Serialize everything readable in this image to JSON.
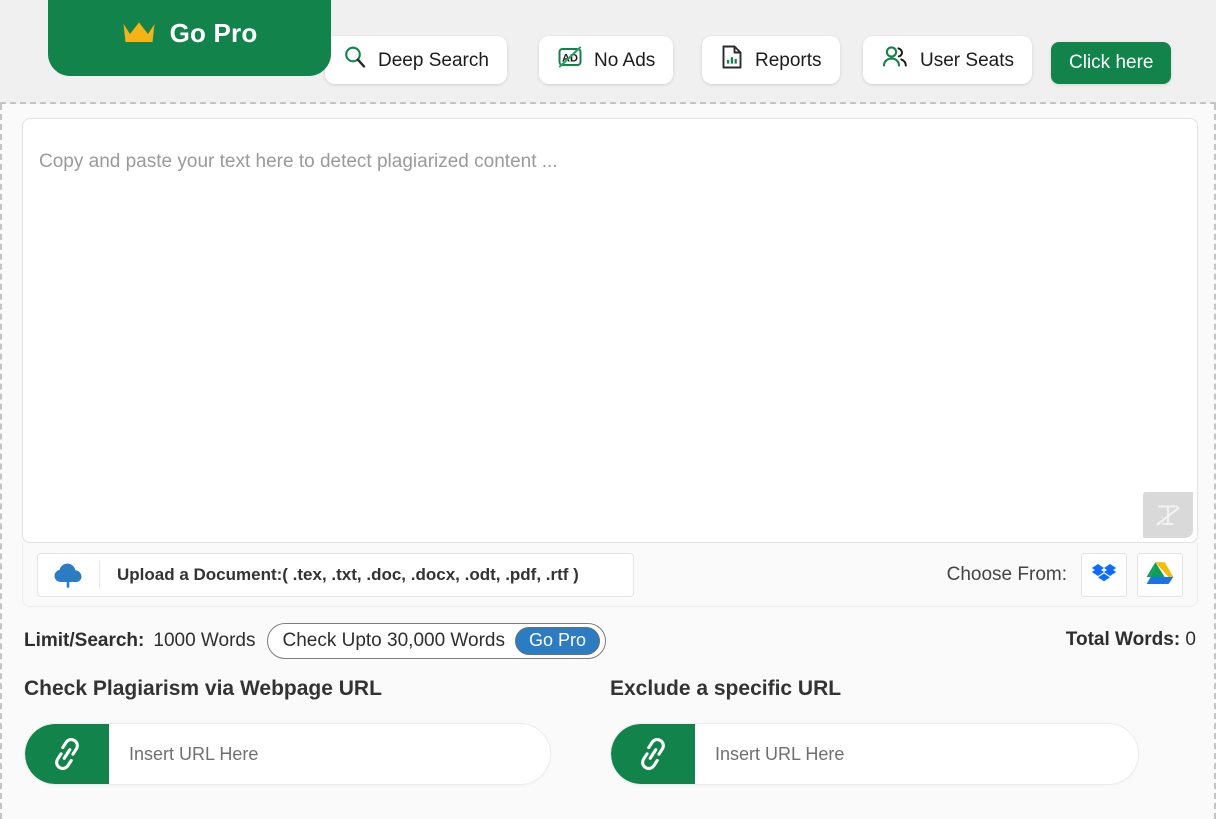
{
  "promo": {
    "banner": {
      "label": "Go Pro",
      "icon": "crown-icon",
      "bg_color": "#12834a",
      "crown_color": "#f5b315"
    },
    "buttons": [
      {
        "id": "deep-search",
        "label": "Deep Search",
        "icon": "search-icon"
      },
      {
        "id": "no-ads",
        "label": "No Ads",
        "icon": "no-ads-icon"
      },
      {
        "id": "reports",
        "label": "Reports",
        "icon": "report-document-icon"
      },
      {
        "id": "user-seats",
        "label": "User Seats",
        "icon": "users-icon"
      }
    ],
    "cta": {
      "label": "Click here",
      "bg_color": "#12834a"
    }
  },
  "editor": {
    "placeholder": "Copy and paste your text here to detect plagiarized content ...",
    "value": "",
    "text_tool_icon": "text-format-icon"
  },
  "upload": {
    "icon": "cloud-upload-icon",
    "label": "Upload a Document:( .tex, .txt, .doc, .docx, .odt, .pdf, .rtf )",
    "choose_from_label": "Choose From:",
    "providers": [
      {
        "id": "dropbox",
        "icon": "dropbox-icon"
      },
      {
        "id": "google-drive",
        "icon": "google-drive-icon"
      }
    ]
  },
  "limits": {
    "label": "Limit/Search:",
    "value": "1000 Words",
    "upgrade_text": "Check Upto 30,000 Words",
    "upgrade_badge": "Go Pro",
    "badge_color": "#2b7cc2",
    "total_words_label": "Total Words:",
    "total_words_value": "0"
  },
  "url_sections": [
    {
      "id": "check",
      "heading": "Check Plagiarism via Webpage URL",
      "placeholder": "Insert URL Here",
      "value": "",
      "icon": "link-icon"
    },
    {
      "id": "exclude",
      "heading": "Exclude a specific URL",
      "placeholder": "Insert URL Here",
      "value": "",
      "icon": "link-icon"
    }
  ]
}
